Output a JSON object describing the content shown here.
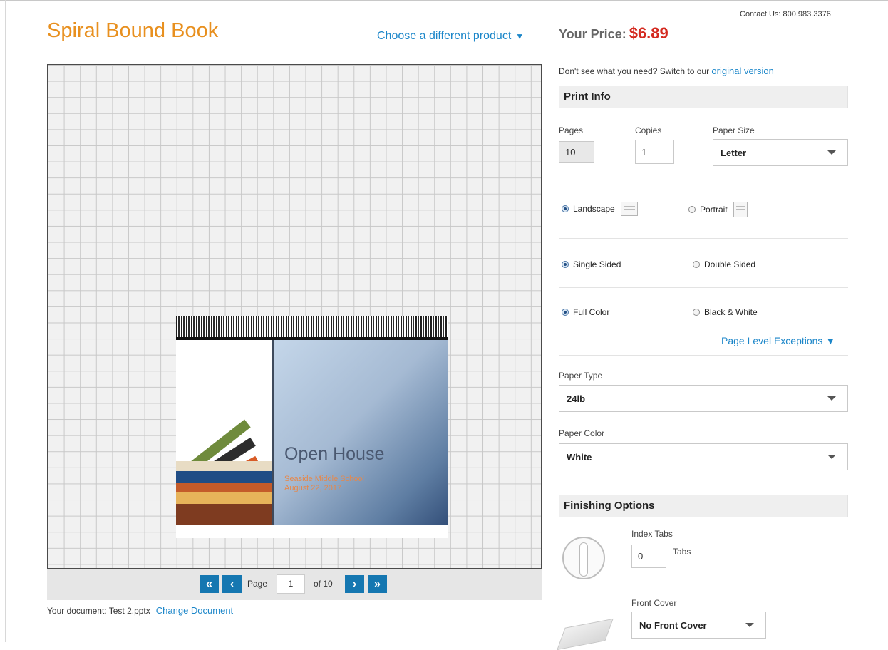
{
  "header": {
    "title": "Spiral Bound Book",
    "choose_product": "Choose a different product",
    "contact": "Contact Us: 800.983.3376",
    "price_label": "Your Price:",
    "price_value": "$6.89"
  },
  "preview": {
    "slide_title": "Open House",
    "slide_subtitle_1": "Seaside Middle School",
    "slide_subtitle_2": "August 22, 2017"
  },
  "pager": {
    "page_label": "Page",
    "current_page": "1",
    "of_label": "of 10",
    "first_icon": "«",
    "prev_icon": "‹",
    "next_icon": "›",
    "last_icon": "»"
  },
  "document": {
    "label": "Your document: Test 2.pptx",
    "change_link": "Change Document"
  },
  "switch": {
    "text": "Don't see what you need? Switch to our ",
    "link": "original version"
  },
  "print_info": {
    "heading": "Print Info",
    "pages_label": "Pages",
    "pages_value": "10",
    "copies_label": "Copies",
    "copies_value": "1",
    "paper_size_label": "Paper Size",
    "paper_size_value": "Letter",
    "orientation_landscape": "Landscape",
    "orientation_portrait": "Portrait",
    "sided_single": "Single Sided",
    "sided_double": "Double Sided",
    "color_full": "Full Color",
    "color_bw": "Black & White",
    "exceptions_link": "Page Level Exceptions ▼",
    "paper_type_label": "Paper Type",
    "paper_type_value": "24lb",
    "paper_color_label": "Paper Color",
    "paper_color_value": "White"
  },
  "finishing": {
    "heading": "Finishing Options",
    "index_tabs_label": "Index Tabs",
    "index_tabs_value": "0",
    "tabs_unit": "Tabs",
    "front_cover_label": "Front Cover",
    "front_cover_value": "No Front Cover"
  }
}
